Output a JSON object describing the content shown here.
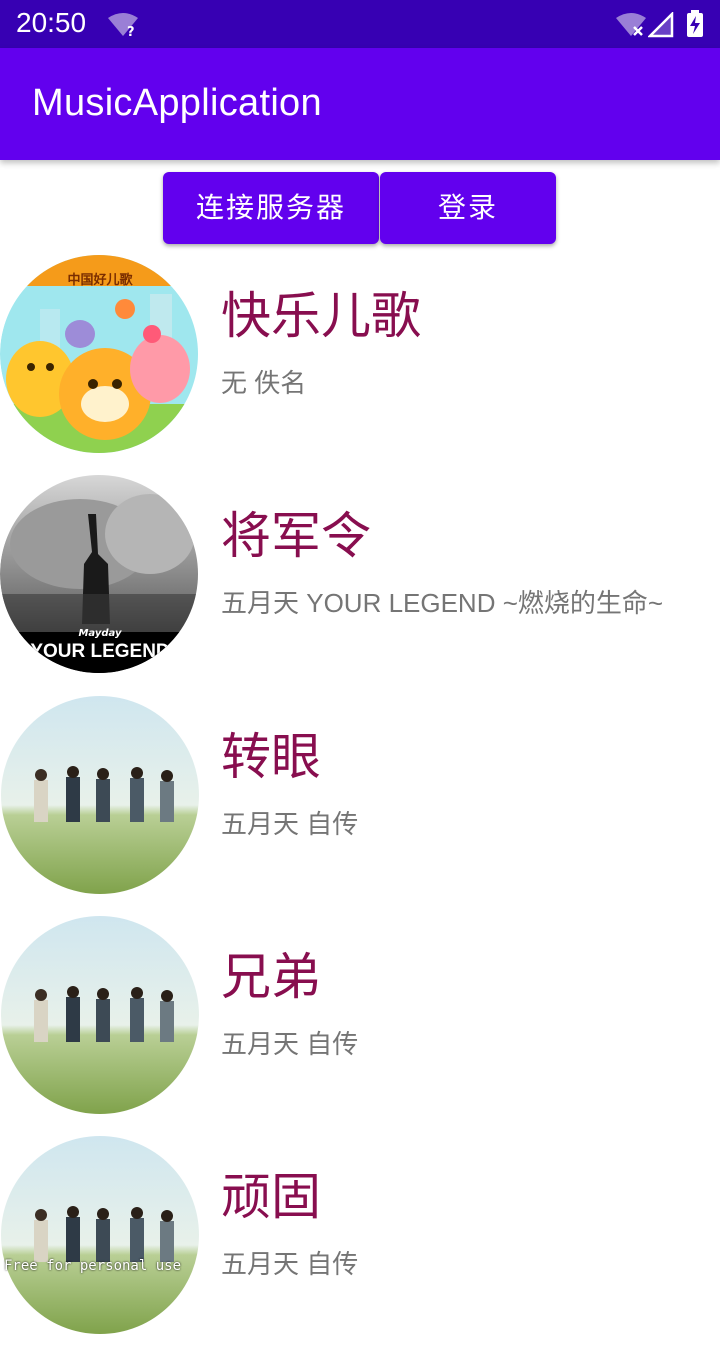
{
  "status_bar": {
    "time": "20:50",
    "icons": [
      "wifi-unknown-icon",
      "wifi-off-icon",
      "cell-signal-icon",
      "battery-charging-icon"
    ],
    "unknown_mark": "?"
  },
  "app_bar": {
    "title": "MusicApplication"
  },
  "buttons": {
    "connect": "连接服务器",
    "login": "登录"
  },
  "colors": {
    "primary": "#6200ee",
    "primary_dark": "#3700b3",
    "title": "#880e4f",
    "subtitle": "#757575"
  },
  "songs": [
    {
      "title": "快乐儿歌",
      "artist": "无 佚名",
      "cover": "kids-cartoon-cover",
      "cover_text": "中国好儿歌"
    },
    {
      "title": "将军令",
      "artist": "五月天 YOUR LEGEND ~燃烧的生命~",
      "cover": "your-legend-cover",
      "cover_text": "YOUR LEGEND",
      "cover_brand": "Mayday"
    },
    {
      "title": "转眼",
      "artist": "五月天 自传",
      "cover": "autobiography-cover"
    },
    {
      "title": "兄弟",
      "artist": "五月天 自传",
      "cover": "autobiography-cover"
    },
    {
      "title": "顽固",
      "artist": "五月天 自传",
      "cover": "autobiography-cover"
    }
  ],
  "watermark": "Free for personal use"
}
